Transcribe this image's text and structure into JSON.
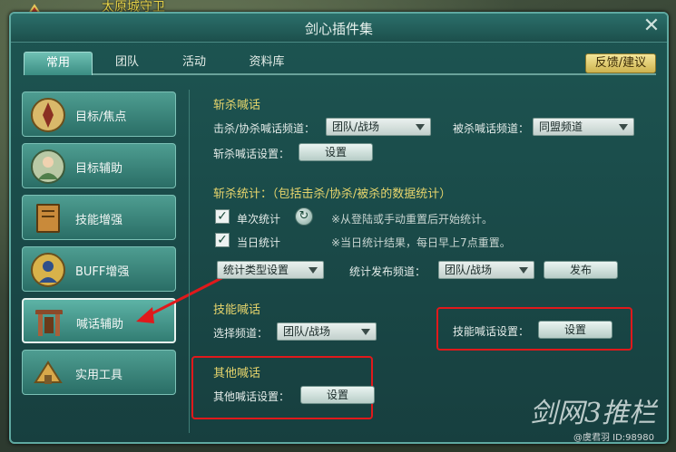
{
  "npc_name": "太原城守卫",
  "window": {
    "title": "剑心插件集",
    "close_symbol": "✕"
  },
  "tabs": [
    {
      "label": "常用",
      "active": true
    },
    {
      "label": "团队",
      "active": false
    },
    {
      "label": "活动",
      "active": false
    },
    {
      "label": "资料库",
      "active": false
    }
  ],
  "feedback_label": "反馈/建议",
  "sidebar": [
    {
      "label": "目标/焦点",
      "icon": "target-icon",
      "active": false
    },
    {
      "label": "目标辅助",
      "icon": "character-icon",
      "active": false
    },
    {
      "label": "技能增强",
      "icon": "skill-book-icon",
      "active": false
    },
    {
      "label": "BUFF增强",
      "icon": "buff-icon",
      "active": false
    },
    {
      "label": "喊话辅助",
      "icon": "gate-icon",
      "active": true
    },
    {
      "label": "实用工具",
      "icon": "tools-icon",
      "active": false
    }
  ],
  "kill_shout": {
    "title": "斩杀喊话",
    "kill_channel_label": "击杀/协杀喊话频道：",
    "kill_channel_value": "团队/战场",
    "killed_channel_label": "被杀喊话频道：",
    "killed_channel_value": "同盟频道",
    "settings_label": "斩杀喊话设置：",
    "settings_button": "设置"
  },
  "kill_stats": {
    "title": "斩杀统计：（包括击杀/协杀/被杀的数据统计）",
    "single_label": "单次统计",
    "single_checked": true,
    "single_note": "※从登陆或手动重置后开始统计。",
    "daily_label": "当日统计",
    "daily_checked": true,
    "daily_note": "※当日统计结果，每日早上7点重置。",
    "type_dropdown": "统计类型设置",
    "publish_channel_label": "统计发布频道：",
    "publish_channel_value": "团队/战场",
    "publish_button": "发布",
    "check_symbol": "✓",
    "refresh_symbol": "↻"
  },
  "skill_shout": {
    "title": "技能喊话",
    "channel_label": "选择频道：",
    "channel_value": "团队/战场",
    "settings_label": "技能喊话设置：",
    "settings_button": "设置"
  },
  "other_shout": {
    "title": "其他喊话",
    "settings_label": "其他喊话设置：",
    "settings_button": "设置"
  },
  "watermark": {
    "main": "剑网3推栏",
    "sub": "@虞君羽 ID:98980"
  },
  "colors": {
    "annotation_red": "#e0191b",
    "section_title": "#e7d56c"
  }
}
